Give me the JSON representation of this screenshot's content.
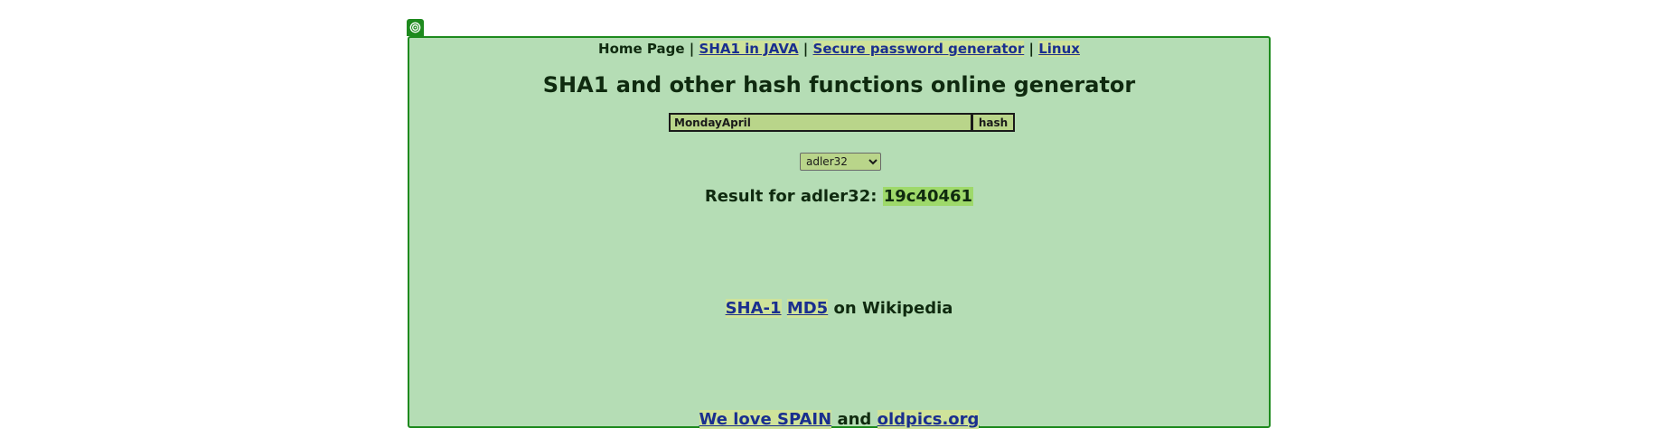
{
  "logo_icon": "spiral-icon",
  "nav": {
    "home": "Home Page",
    "separator": "|",
    "links": [
      "SHA1 in JAVA",
      "Secure password generator",
      "Linux"
    ]
  },
  "title": "SHA1 and other hash functions online generator",
  "form": {
    "input_value": "MondayApril",
    "button_label": "hash",
    "selected_algorithm": "adler32"
  },
  "result": {
    "label": "Result for adler32:",
    "value": "19c40461"
  },
  "wiki": {
    "link1": "SHA-1",
    "link2": "MD5",
    "suffix": "on Wikipedia"
  },
  "footer": {
    "link1": "We love SPAIN",
    "conjunction": "and",
    "link2": "oldpics.org"
  },
  "colors": {
    "panel_background": "#b5ddb5",
    "panel_border": "#1e8a1e",
    "link": "#1a2f8f",
    "highlight": "#9ed96a"
  }
}
